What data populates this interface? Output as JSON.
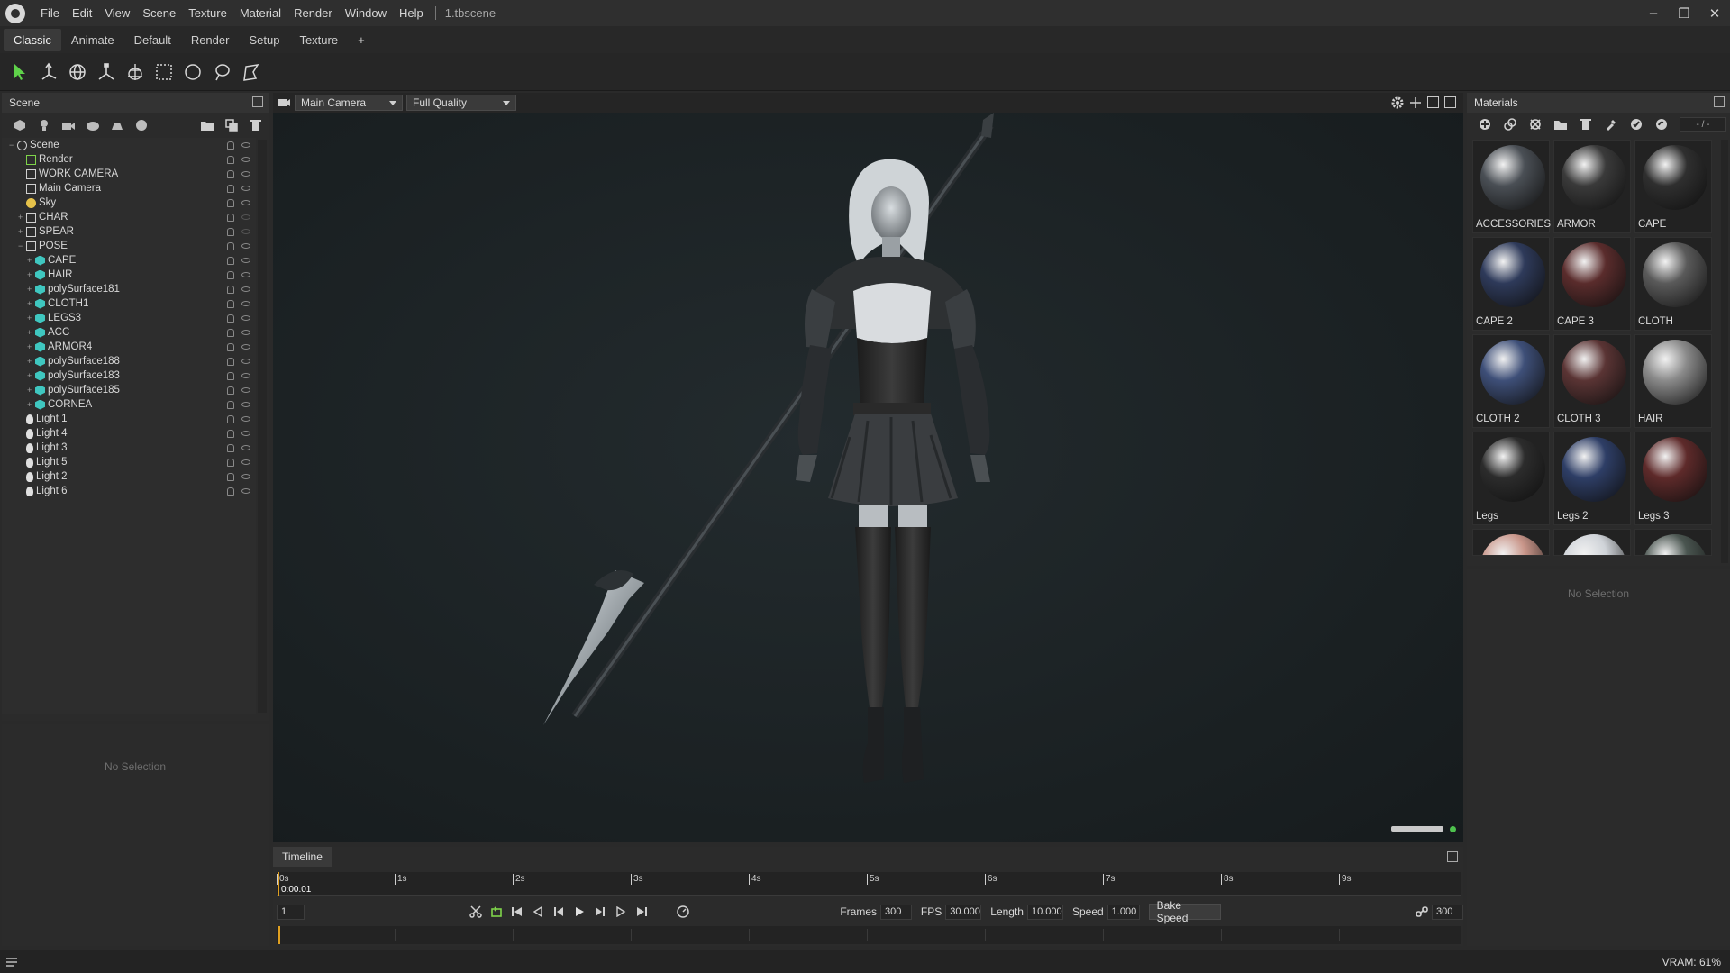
{
  "menubar": {
    "items": [
      "File",
      "Edit",
      "View",
      "Scene",
      "Texture",
      "Material",
      "Render",
      "Window",
      "Help"
    ],
    "doc_title": "1.tbscene"
  },
  "workspace_tabs": [
    "Classic",
    "Animate",
    "Default",
    "Render",
    "Setup",
    "Texture",
    "+"
  ],
  "scene": {
    "title": "Scene",
    "no_selection": "No Selection",
    "tree": [
      {
        "label": "Scene",
        "depth": 0,
        "icon": "scene-icon",
        "visible": true
      },
      {
        "label": "Render",
        "depth": 1,
        "icon": "render-icon",
        "visible": true
      },
      {
        "label": "WORK CAMERA",
        "depth": 1,
        "icon": "camera-icon",
        "visible": true
      },
      {
        "label": "Main Camera",
        "depth": 1,
        "icon": "camera-icon",
        "visible": true
      },
      {
        "label": "Sky",
        "depth": 1,
        "icon": "sky-icon",
        "visible": true
      },
      {
        "label": "CHAR",
        "depth": 1,
        "icon": "group-icon",
        "visible": false
      },
      {
        "label": "SPEAR",
        "depth": 1,
        "icon": "group-icon",
        "visible": false
      },
      {
        "label": "POSE",
        "depth": 1,
        "icon": "group-icon",
        "visible": true
      },
      {
        "label": "CAPE",
        "depth": 2,
        "icon": "mesh-icon",
        "visible": true
      },
      {
        "label": "HAIR",
        "depth": 2,
        "icon": "mesh-icon",
        "visible": true
      },
      {
        "label": "polySurface181",
        "depth": 2,
        "icon": "mesh-icon",
        "visible": true
      },
      {
        "label": "CLOTH1",
        "depth": 2,
        "icon": "mesh-icon",
        "visible": true
      },
      {
        "label": "LEGS3",
        "depth": 2,
        "icon": "mesh-icon",
        "visible": true
      },
      {
        "label": "ACC",
        "depth": 2,
        "icon": "mesh-icon",
        "visible": true
      },
      {
        "label": "ARMOR4",
        "depth": 2,
        "icon": "mesh-icon",
        "visible": true
      },
      {
        "label": "polySurface188",
        "depth": 2,
        "icon": "mesh-icon",
        "visible": true
      },
      {
        "label": "polySurface183",
        "depth": 2,
        "icon": "mesh-icon",
        "visible": true
      },
      {
        "label": "polySurface185",
        "depth": 2,
        "icon": "mesh-icon",
        "visible": true
      },
      {
        "label": "CORNEA",
        "depth": 2,
        "icon": "mesh-icon",
        "visible": true
      },
      {
        "label": "Light 1",
        "depth": 1,
        "icon": "light-icon",
        "visible": true
      },
      {
        "label": "Light 4",
        "depth": 1,
        "icon": "light-icon",
        "visible": true
      },
      {
        "label": "Light 3",
        "depth": 1,
        "icon": "light-icon",
        "visible": true
      },
      {
        "label": "Light 5",
        "depth": 1,
        "icon": "light-icon",
        "visible": true
      },
      {
        "label": "Light 2",
        "depth": 1,
        "icon": "light-icon",
        "visible": true
      },
      {
        "label": "Light 6",
        "depth": 1,
        "icon": "light-icon",
        "visible": true
      }
    ]
  },
  "viewport": {
    "camera": "Main Camera",
    "quality": "Full Quality"
  },
  "timeline": {
    "title": "Timeline",
    "ticks": [
      "0s",
      "1s",
      "2s",
      "3s",
      "4s",
      "5s",
      "6s",
      "7s",
      "8s",
      "9s"
    ],
    "current_time": "0:00.01",
    "frame": "1",
    "frames_label": "Frames",
    "frames": "300",
    "fps_label": "FPS",
    "fps": "30.000",
    "length_label": "Length",
    "length": "10.000",
    "speed_label": "Speed",
    "speed": "1.000",
    "bake_label": "Bake Speed",
    "end_frame": "300"
  },
  "materials": {
    "title": "Materials",
    "field": "- / -",
    "no_selection": "No Selection",
    "items": [
      {
        "name": "ACCESSORIES",
        "color": "#4a4f55"
      },
      {
        "name": "ARMOR",
        "color": "#3a3a3a"
      },
      {
        "name": "CAPE",
        "color": "#2f2f2f"
      },
      {
        "name": "CAPE 2",
        "color": "#2e3a5a"
      },
      {
        "name": "CAPE 3",
        "color": "#5a2c2c"
      },
      {
        "name": "CLOTH",
        "color": "#5a5a5a"
      },
      {
        "name": "CLOTH 2",
        "color": "#3e4f78"
      },
      {
        "name": "CLOTH 3",
        "color": "#5a3434"
      },
      {
        "name": "HAIR",
        "color": "#8a8a8a"
      },
      {
        "name": "Legs",
        "color": "#2c2c2c"
      },
      {
        "name": "Legs 2",
        "color": "#2e3e66"
      },
      {
        "name": "Legs 3",
        "color": "#5e2a2a"
      },
      {
        "name": "",
        "color": "#c9968a"
      },
      {
        "name": "",
        "color": "#cfd3d8"
      },
      {
        "name": "",
        "color": "#4a5550"
      }
    ]
  },
  "status": {
    "vram": "VRAM: 61%"
  }
}
